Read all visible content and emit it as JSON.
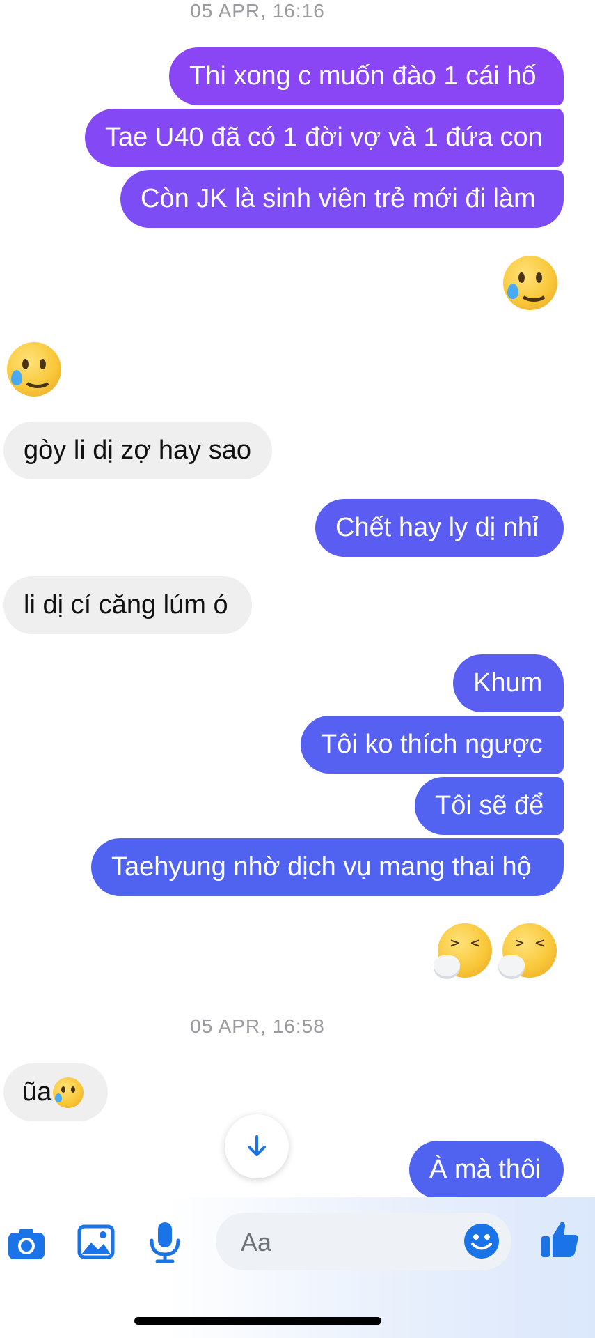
{
  "timestamps": [
    "05 APR, 16:16",
    "05 APR, 16:58"
  ],
  "sent_group1": [
    "Thi xong c muốn đào 1 cái hố",
    "Tae U40 đã có 1 đời vợ và 1 đứa con",
    "Còn JK là sinh viên trẻ mới đi làm"
  ],
  "received": [
    "gòy li dị zợ hay sao",
    "li dị cí căng lúm ó",
    "ũa"
  ],
  "sent_single1": "Chết hay ly dị nhỉ",
  "sent_group2": [
    "Khum",
    "Tôi ko thích ngược",
    "Tôi sẽ để",
    "Taehyung nhờ dịch vụ mang thai hộ"
  ],
  "sent_last": "À mà thôi",
  "emojis": {
    "sent_reaction": "smiling-face-with-tear",
    "received_reaction": "smiling-face-with-tear",
    "sneeze_pair": "sneezing-face",
    "inline": "smiling-face-with-tear"
  },
  "composer": {
    "placeholder": "Aa",
    "icons": [
      "camera-icon",
      "image-icon",
      "microphone-icon",
      "emoji-icon",
      "thumbs-up-icon"
    ]
  },
  "colors": {
    "sent_top": "#8a46f5",
    "sent_mid": "#7a4ef4",
    "sent_bottom": "#4f63f0",
    "received_bg": "#efefef",
    "accent": "#1b73e8"
  }
}
